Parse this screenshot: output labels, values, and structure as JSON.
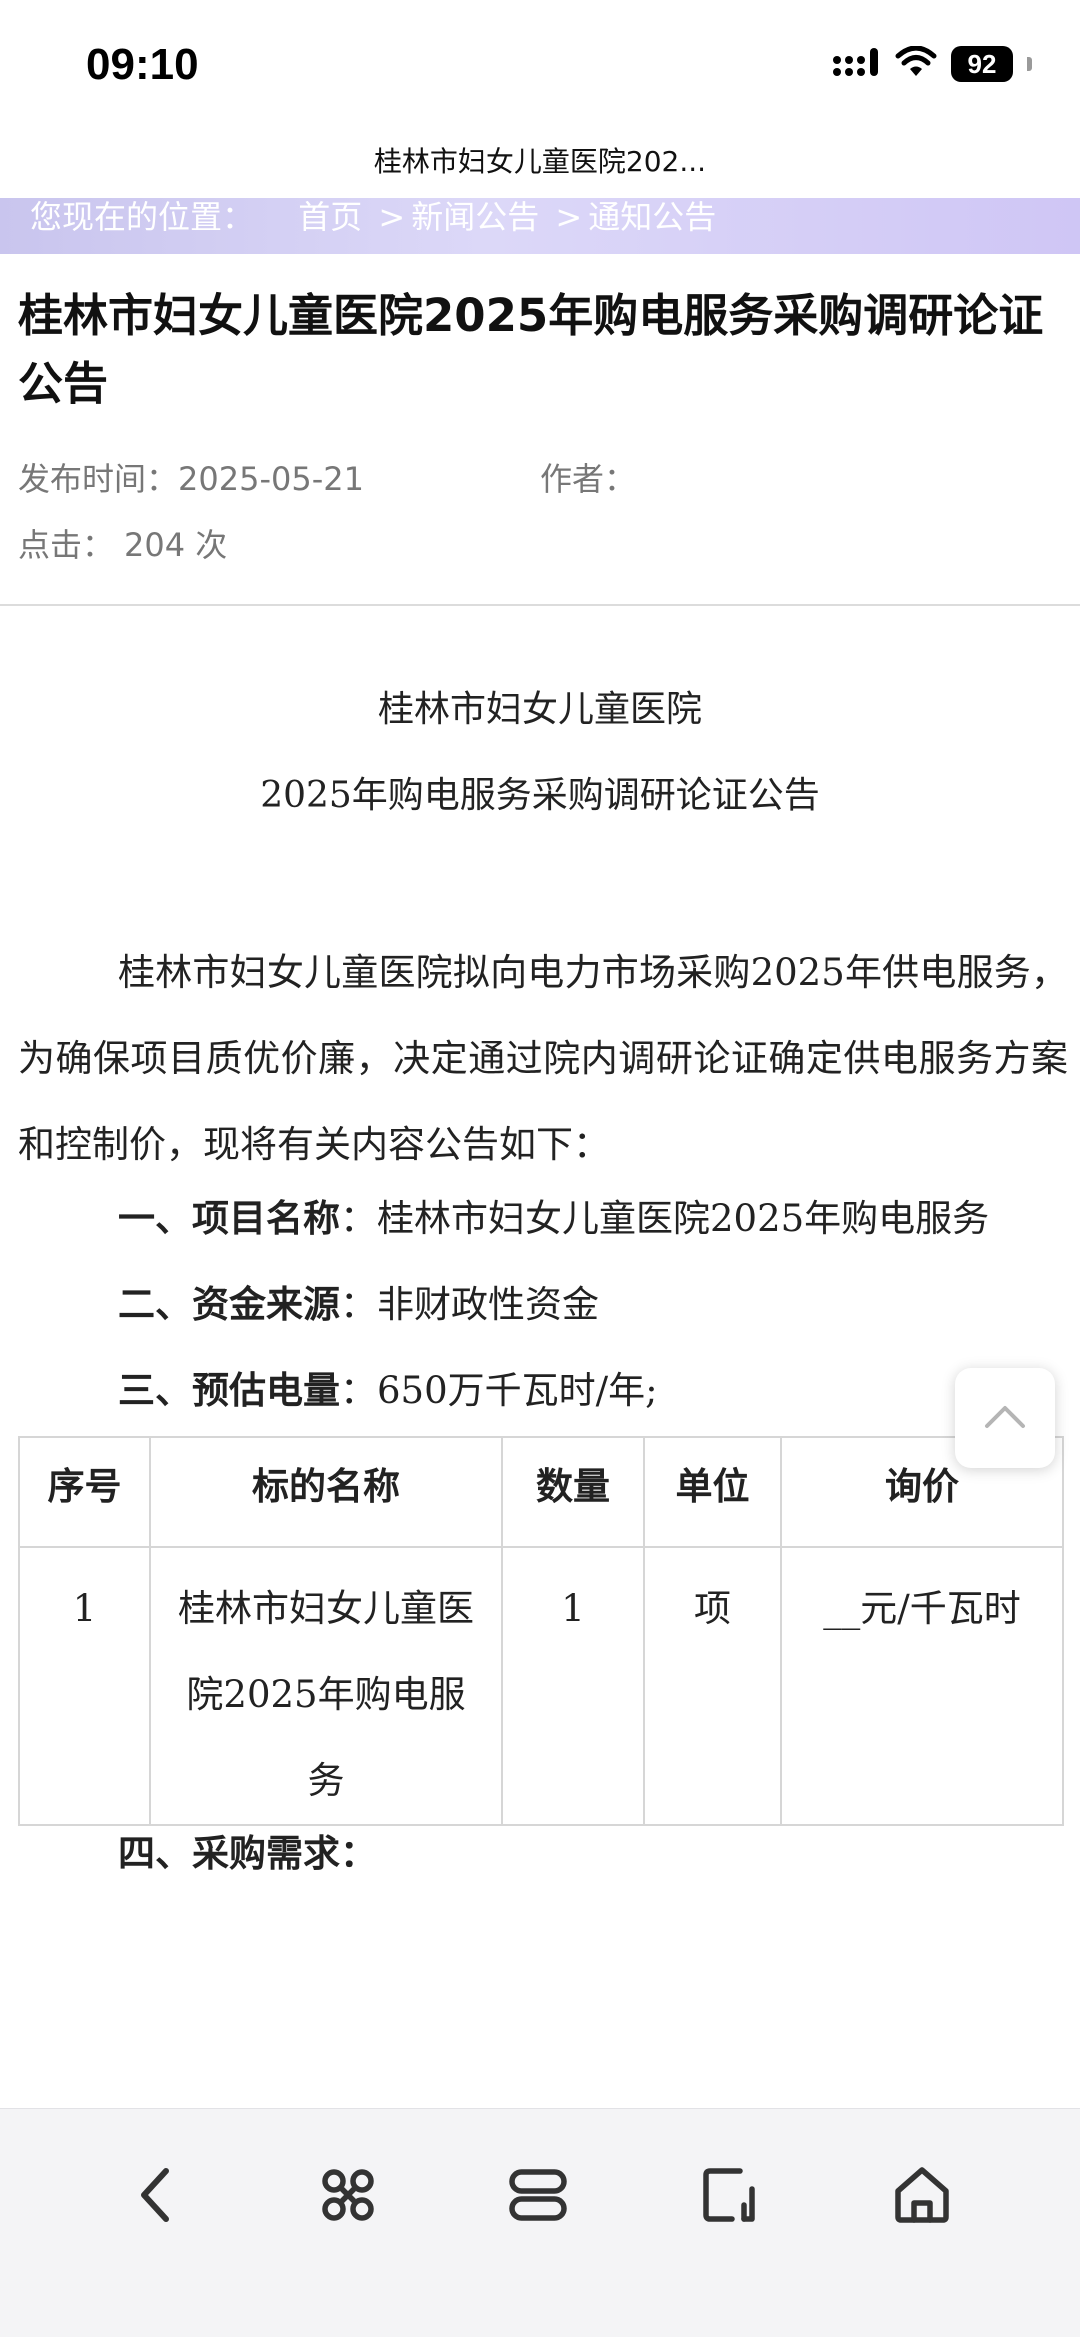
{
  "status_bar": {
    "time": "09:10",
    "battery": "92"
  },
  "page": {
    "tab_title": "桂林市妇女儿童医院202...",
    "breadcrumb": {
      "prefix": "您现在的位置：",
      "home": "首页",
      "sep1": ">",
      "news": "新闻公告",
      "sep2": ">",
      "notice": "通知公告"
    }
  },
  "article": {
    "title": "桂林市妇女儿童医院2025年购电服务采购调研论证公告",
    "publish_label": "发布时间：",
    "publish_date": "2025-05-21",
    "author_label": "作者：",
    "clicks_label": "点击：",
    "clicks_value": "204 次"
  },
  "content": {
    "center_line1": "桂林市妇女儿童医院",
    "center_line2": "2025年购电服务采购调研论证公告",
    "intro": "桂林市妇女儿童医院拟向电力市场采购2025年供电服务，为确保项目质优价廉，决定通过院内调研论证确定供电服务方案和控制价，现将有关内容公告如下：",
    "items": [
      {
        "label": "一、项目名称",
        "value": "：桂林市妇女儿童医院2025年购电服务"
      },
      {
        "label": "二、资金来源",
        "value": "：非财政性资金"
      },
      {
        "label": "三、预估电量",
        "value": "：650万千瓦时/年;"
      },
      {
        "label": "四、采购需求：",
        "value": ""
      }
    ],
    "table": {
      "headers": [
        "序号",
        "标的名称",
        "数量",
        "单位",
        "询价"
      ],
      "rows": [
        [
          "1",
          "桂林市妇女儿童医院2025年购电服务",
          "1",
          "项",
          "__元/千瓦时"
        ]
      ]
    }
  },
  "icons": {
    "back_to_top": "chevron-up-icon",
    "nav": [
      "back-arrow-icon",
      "apps-icon",
      "tabs-icon",
      "share-icon",
      "home-icon"
    ]
  }
}
